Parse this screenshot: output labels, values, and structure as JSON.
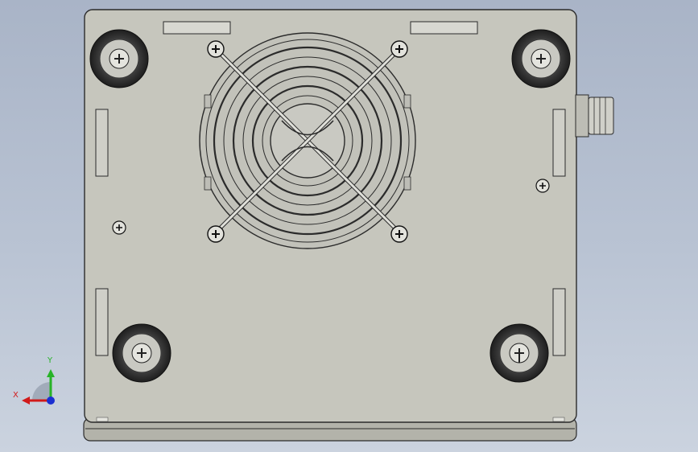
{
  "viewport": {
    "background_top": "#a9b4c7",
    "background_bottom": "#cbd3df"
  },
  "model": {
    "plate_color": "#c6c6bd",
    "edge_color": "#2b2b2b",
    "foot_color": "#2a2a2a",
    "screw_color": "#e2e2dc"
  },
  "triad": {
    "x_label": "X",
    "y_label": "Y",
    "x_color": "#d11a1a",
    "y_color": "#27b327",
    "z_color": "#1a2fd1"
  }
}
